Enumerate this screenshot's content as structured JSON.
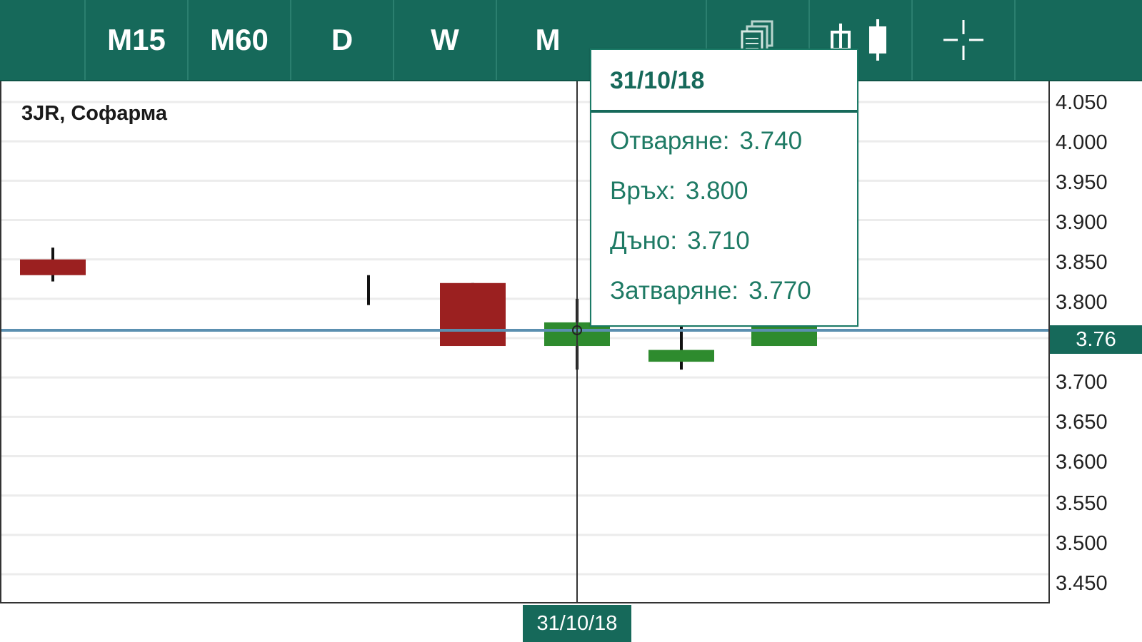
{
  "toolbar": {
    "timeframes": [
      "M15",
      "M60",
      "D",
      "W",
      "M"
    ],
    "icons": [
      "pages-icon",
      "candlestick-icon",
      "crosshair-icon"
    ]
  },
  "chart": {
    "instrument_label": "3JR, Софарма",
    "current_price": "3.76",
    "cursor_date": "31/10/18",
    "y_ticks": [
      "4.050",
      "4.000",
      "3.950",
      "3.900",
      "3.850",
      "3.800",
      "3.76",
      "3.700",
      "3.650",
      "3.600",
      "3.550",
      "3.500",
      "3.450"
    ]
  },
  "tooltip": {
    "date": "31/10/18",
    "open_label": "Отваряне:",
    "open_value": "3.740",
    "high_label": "Връх:",
    "high_value": "3.800",
    "low_label": "Дъно:",
    "low_value": "3.710",
    "close_label": "Затваряне:",
    "close_value": "3.770"
  },
  "chart_data": {
    "type": "candlestick",
    "ylim": [
      3.45,
      4.05
    ],
    "candles": [
      {
        "open": 3.85,
        "high": 3.865,
        "low": 3.822,
        "close": 3.83,
        "direction": "down"
      },
      {
        "open": 3.81,
        "high": 3.83,
        "low": 3.792,
        "close": 3.81,
        "direction": "flat"
      },
      {
        "open": 3.82,
        "high": 3.82,
        "low": 3.74,
        "close": 3.74,
        "direction": "down"
      },
      {
        "open": 3.74,
        "high": 3.8,
        "low": 3.71,
        "close": 3.77,
        "direction": "up"
      },
      {
        "open": 3.72,
        "high": 3.77,
        "low": 3.71,
        "close": 3.735,
        "direction": "up"
      },
      {
        "open": 3.74,
        "high": 3.8,
        "low": 3.74,
        "close": 3.77,
        "direction": "up"
      }
    ],
    "current_price": 3.76,
    "colors": {
      "up": "#2e8b2e",
      "down": "#9b2020",
      "accent": "#16695a"
    }
  }
}
